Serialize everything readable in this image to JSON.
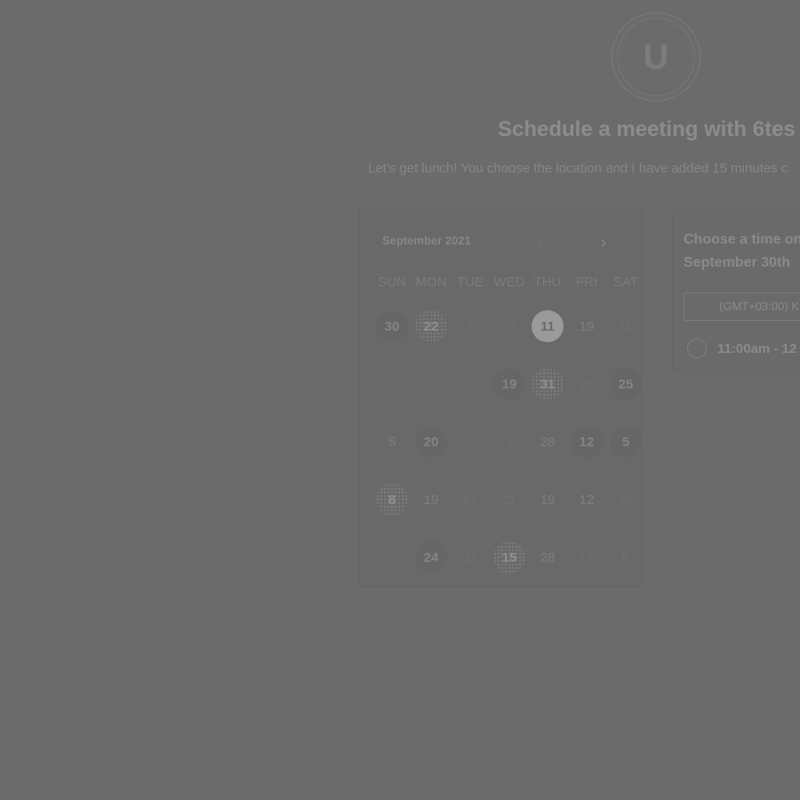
{
  "header": {
    "avatar_letter": "U",
    "title": "Schedule a meeting with 6tes",
    "subtitle": "Let's get lunch! You choose the location and I have added 15 minutes c"
  },
  "calendar": {
    "month_label": "September 2021",
    "prev_icon": "chevron-left-icon",
    "next_icon": "chevron-right-icon",
    "weekdays": [
      "SUN",
      "MON",
      "TUE",
      "WED",
      "THU",
      "FRI",
      "SAT"
    ],
    "weeks": [
      [
        {
          "d": "30",
          "s": "avail"
        },
        {
          "d": "22",
          "s": "dots"
        },
        {
          "d": "1",
          "s": "dim"
        },
        {
          "d": "17",
          "s": "dim"
        },
        {
          "d": "11",
          "s": "sel"
        },
        {
          "d": "19",
          "s": "mid"
        },
        {
          "d": "11",
          "s": "dim"
        }
      ],
      [
        {
          "d": "23",
          "s": "dim"
        },
        {
          "d": "27",
          "s": "dim"
        },
        {
          "d": "17",
          "s": "dim"
        },
        {
          "d": "19",
          "s": "avail"
        },
        {
          "d": "31",
          "s": "dots"
        },
        {
          "d": "21",
          "s": "dim"
        },
        {
          "d": "25",
          "s": "avail"
        }
      ],
      [
        {
          "d": "5",
          "s": "mid"
        },
        {
          "d": "20",
          "s": "avail"
        },
        {
          "d": "15",
          "s": "dim"
        },
        {
          "d": "9",
          "s": "dim"
        },
        {
          "d": "28",
          "s": "mid"
        },
        {
          "d": "12",
          "s": "avail"
        },
        {
          "d": "5",
          "s": "avail"
        }
      ],
      [
        {
          "d": "8",
          "s": "dots"
        },
        {
          "d": "19",
          "s": "mid"
        },
        {
          "d": "21",
          "s": "dim"
        },
        {
          "d": "11",
          "s": "dim"
        },
        {
          "d": "19",
          "s": "mid"
        },
        {
          "d": "12",
          "s": "mid"
        },
        {
          "d": "25",
          "s": "dim"
        }
      ],
      [
        {
          "d": "1",
          "s": "dim"
        },
        {
          "d": "24",
          "s": "avail"
        },
        {
          "d": "31",
          "s": "dim"
        },
        {
          "d": "15",
          "s": "dots"
        },
        {
          "d": "28",
          "s": "mid"
        },
        {
          "d": "17",
          "s": "dim"
        },
        {
          "d": "8",
          "s": "dim"
        }
      ]
    ]
  },
  "times": {
    "heading_line1": "Choose a time on",
    "heading_line2": "September 30th",
    "timezone": "(GMT+03:00) K",
    "slot_label": "11:00am - 12"
  }
}
